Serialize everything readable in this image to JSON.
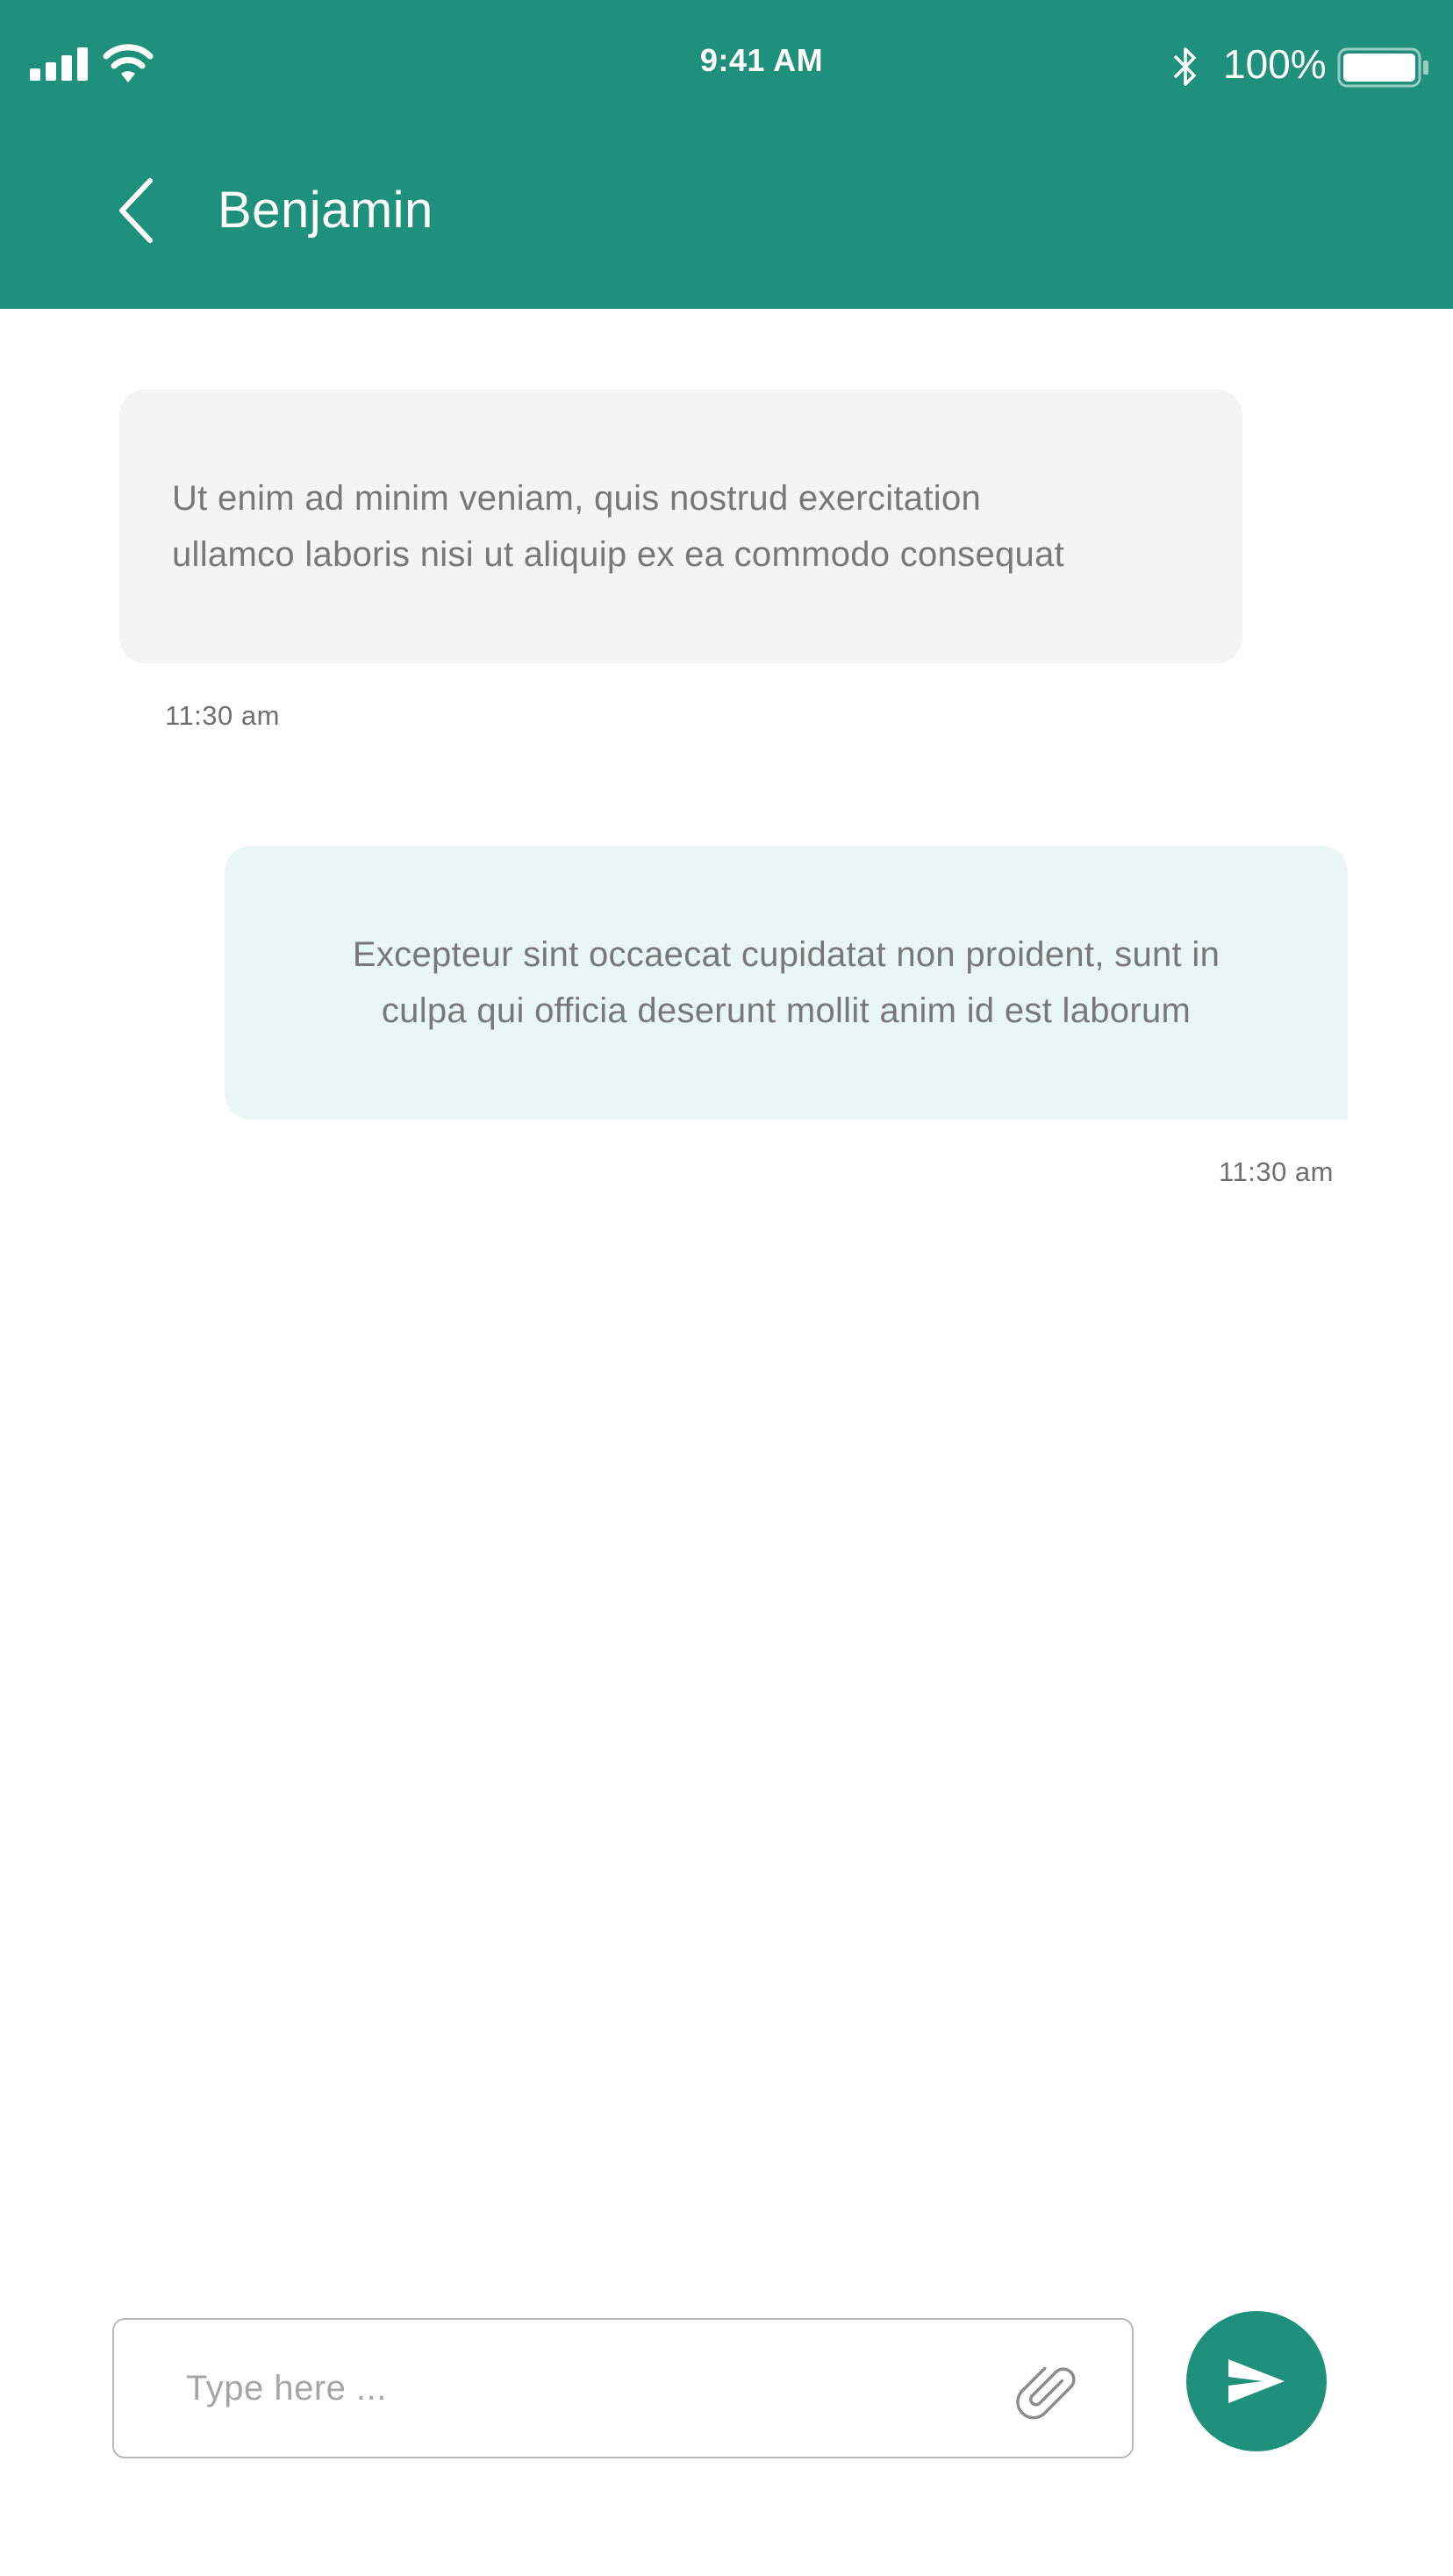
{
  "status_bar": {
    "time": "9:41 AM",
    "battery_percent": "100%",
    "battery_level": 1.0,
    "icons": [
      "signal-icon",
      "wifi-icon",
      "bluetooth-icon",
      "battery-icon"
    ]
  },
  "header": {
    "contact_name": "Benjamin",
    "back_icon": "chevron-left-icon"
  },
  "messages": [
    {
      "direction": "incoming",
      "lines": [
        "Ut enim ad minim veniam, quis nostrud exercitation",
        "ullamco laboris nisi ut aliquip ex ea commodo consequat"
      ],
      "time": "11:30 am"
    },
    {
      "direction": "outgoing",
      "lines": [
        "Excepteur sint occaecat cupidatat non proident, sunt in",
        "culpa qui officia deserunt mollit anim id est laborum"
      ],
      "time": "11:30 am"
    }
  ],
  "composer": {
    "placeholder": "Type here ...",
    "attach_icon": "paperclip-icon",
    "send_icon": "send-icon"
  },
  "colors": {
    "accent": "#1e907b",
    "incoming_bubble": "#f4f4f4",
    "outgoing_bubble": "#e8f7f3",
    "message_text": "#787878"
  }
}
